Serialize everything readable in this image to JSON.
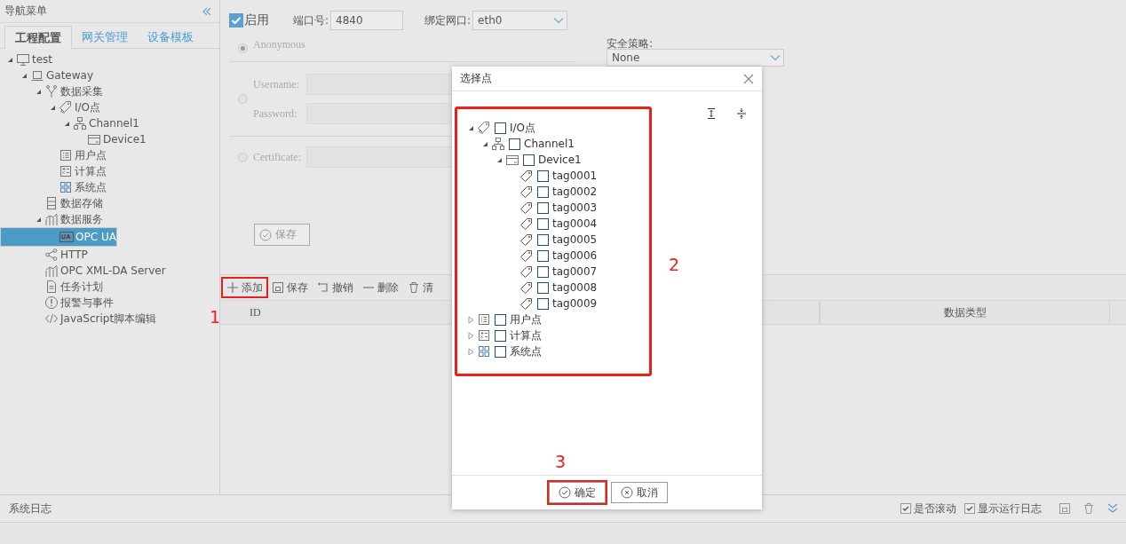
{
  "sidebar": {
    "title": "导航菜单",
    "tabs": [
      {
        "label": "工程配置",
        "selected": true
      },
      {
        "label": "网关管理",
        "selected": false
      },
      {
        "label": "设备模板",
        "selected": false
      }
    ],
    "tree": [
      {
        "label": "test",
        "kind": "monitor",
        "expanded": true,
        "selected": false,
        "children": [
          {
            "label": "Gateway",
            "kind": "laptop",
            "expanded": true,
            "selected": false,
            "children": [
              {
                "label": "数据采集",
                "kind": "fork",
                "expanded": true,
                "selected": false,
                "children": [
                  {
                    "label": "I/O点",
                    "kind": "tags",
                    "expanded": true,
                    "selected": false,
                    "children": [
                      {
                        "label": "Channel1",
                        "kind": "network",
                        "expanded": true,
                        "selected": false,
                        "children": [
                          {
                            "label": "Device1",
                            "kind": "device",
                            "selected": false
                          }
                        ]
                      }
                    ]
                  },
                  {
                    "label": "用户点",
                    "kind": "list",
                    "selected": false
                  },
                  {
                    "label": "计算点",
                    "kind": "calc",
                    "selected": false
                  },
                  {
                    "label": "系统点",
                    "kind": "grid",
                    "selected": false
                  }
                ]
              },
              {
                "label": "数据存储",
                "kind": "storage",
                "selected": false
              },
              {
                "label": "数据服务",
                "kind": "chart",
                "expanded": true,
                "selected": false,
                "children": [
                  {
                    "label": "OPC UA",
                    "kind": "ua",
                    "selected": true
                  }
                ]
              },
              {
                "label": "HTTP",
                "kind": "share",
                "selected": false
              },
              {
                "label": "OPC XML-DA Server",
                "kind": "chart",
                "selected": false
              },
              {
                "label": "任务计划",
                "kind": "doc",
                "selected": false
              },
              {
                "label": "报警与事件",
                "kind": "alert",
                "selected": false
              },
              {
                "label": "JavaScript脚本编辑",
                "kind": "code",
                "selected": false
              }
            ]
          }
        ]
      }
    ]
  },
  "settings": {
    "enable": {
      "label": "启用",
      "checked": true
    },
    "port": {
      "label": "端口号:",
      "value": "4840"
    },
    "bind": {
      "label": "绑定网口:",
      "value": "eth0"
    },
    "auth": [
      {
        "kind": "anonymous",
        "label": "Anonymous",
        "selected": true
      },
      {
        "kind": "userpass",
        "selected": false,
        "fields": [
          {
            "label": "Username:"
          },
          {
            "label": "Password:"
          }
        ]
      },
      {
        "kind": "certificate",
        "selected": false,
        "fields": [
          {
            "label": "Certificate:"
          }
        ]
      }
    ],
    "policy": {
      "label": "安全策略:",
      "value": "None"
    },
    "save": "保存"
  },
  "toolbar": [
    {
      "kind": "add",
      "label": "添加",
      "annotation": "1"
    },
    {
      "kind": "save",
      "label": "保存"
    },
    {
      "kind": "undo",
      "label": "撤销"
    },
    {
      "kind": "remove",
      "label": "删除"
    },
    {
      "kind": "clear",
      "label": "清"
    }
  ],
  "table": {
    "columns": [
      "ID",
      "数据类型"
    ]
  },
  "dialog": {
    "title": "选择点",
    "annotation": "2",
    "tree": [
      {
        "label": "I/O点",
        "kind": "tags",
        "expanded": true,
        "checked": false,
        "children": [
          {
            "label": "Channel1",
            "kind": "network",
            "expanded": true,
            "checked": false,
            "children": [
              {
                "label": "Device1",
                "kind": "device",
                "expanded": true,
                "checked": false,
                "children": [
                  {
                    "label": "tag0001",
                    "kind": "tag",
                    "checked": false
                  },
                  {
                    "label": "tag0002",
                    "kind": "tag",
                    "checked": false
                  },
                  {
                    "label": "tag0003",
                    "kind": "tag",
                    "checked": false
                  },
                  {
                    "label": "tag0004",
                    "kind": "tag",
                    "checked": false
                  },
                  {
                    "label": "tag0005",
                    "kind": "tag",
                    "checked": false
                  },
                  {
                    "label": "tag0006",
                    "kind": "tag",
                    "checked": false
                  },
                  {
                    "label": "tag0007",
                    "kind": "tag",
                    "checked": false
                  },
                  {
                    "label": "tag0008",
                    "kind": "tag",
                    "checked": false
                  },
                  {
                    "label": "tag0009",
                    "kind": "tag",
                    "checked": false
                  }
                ]
              }
            ]
          }
        ]
      },
      {
        "label": "用户点",
        "kind": "list",
        "expanded": false,
        "checked": false
      },
      {
        "label": "计算点",
        "kind": "calc",
        "expanded": false,
        "checked": false
      },
      {
        "label": "系统点",
        "kind": "grid",
        "expanded": false,
        "checked": false
      }
    ],
    "buttons": [
      {
        "kind": "ok",
        "label": "确定",
        "annotation": "3"
      },
      {
        "kind": "cancel",
        "label": "取消"
      }
    ]
  },
  "log": {
    "title": "系统日志",
    "options": [
      {
        "label": "是否滚动",
        "checked": true
      },
      {
        "label": "显示运行日志",
        "checked": true
      }
    ]
  }
}
